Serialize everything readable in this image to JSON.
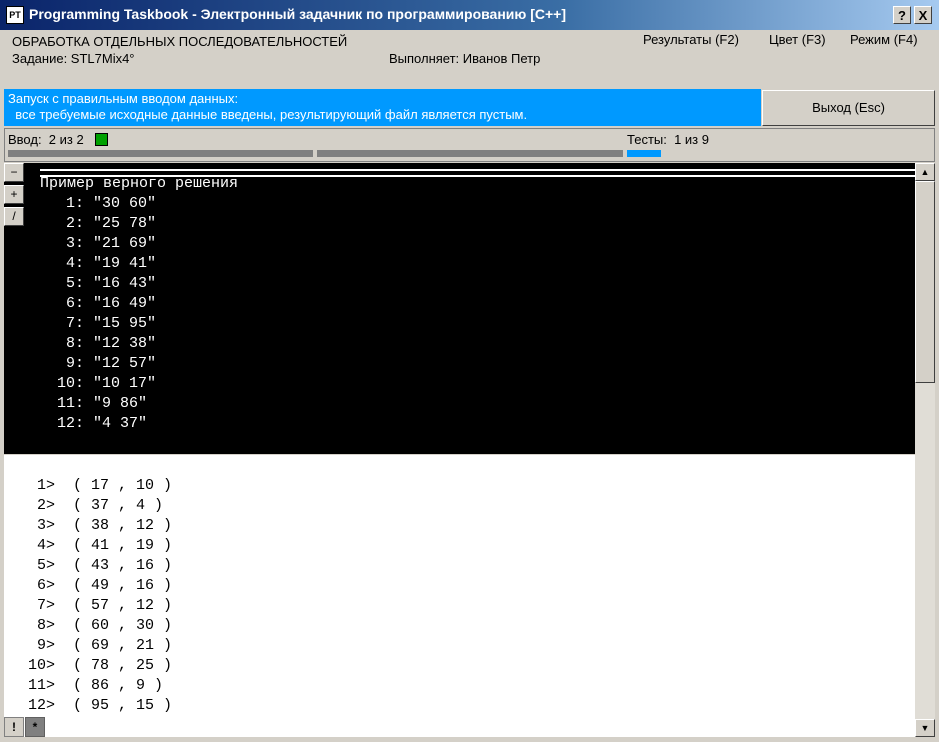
{
  "window": {
    "title": "Programming Taskbook - Электронный задачник по программированию [C++]",
    "icon_text": "PT",
    "help_label": "?",
    "close_label": "X"
  },
  "header": {
    "section": "ОБРАБОТКА ОТДЕЛЬНЫХ ПОСЛЕДОВАТЕЛЬНОСТЕЙ",
    "task": "Задание: STL7Mix4°",
    "performer": "Выполняет: Иванов Петр",
    "menu": [
      {
        "label": "Результаты (F2)"
      },
      {
        "label": "Цвет (F3)"
      },
      {
        "label": "Режим (F4)"
      }
    ]
  },
  "status": {
    "line1": "Запуск с правильным вводом данных:",
    "line2": "  все требуемые исходные данные введены, результирующий файл является пустым.",
    "color": "#0099ff"
  },
  "exit_button": "Выход (Esc)",
  "progress": {
    "input_label": "Ввод:  2 из 2",
    "tests_label": "Тесты:  1 из 9"
  },
  "dark_panel": {
    "side_buttons": [
      "−",
      "+",
      "/"
    ],
    "heading": "Пример верного решения",
    "lines": [
      "  1: \"30 60\"",
      "  2: \"25 78\"",
      "  3: \"21 69\"",
      "  4: \"19 41\"",
      "  5: \"16 43\"",
      "  6: \"16 49\"",
      "  7: \"15 95\"",
      "  8: \"12 38\"",
      "  9: \"12 57\"",
      " 10: \"10 17\"",
      " 11: \"9 86\"",
      " 12: \"4 37\""
    ]
  },
  "white_panel": {
    "lines": [
      " 1>  ( 17 , 10 )",
      " 2>  ( 37 , 4 )",
      " 3>  ( 38 , 12 )",
      " 4>  ( 41 , 19 )",
      " 5>  ( 43 , 16 )",
      " 6>  ( 49 , 16 )",
      " 7>  ( 57 , 12 )",
      " 8>  ( 60 , 30 )",
      " 9>  ( 69 , 21 )",
      "10>  ( 78 , 25 )",
      "11>  ( 86 , 9 )",
      "12>  ( 95 , 15 )"
    ]
  },
  "bottom_buttons": [
    "!",
    "*"
  ],
  "scrollbar": {
    "up_icon": "▲",
    "down_icon": "▼"
  }
}
